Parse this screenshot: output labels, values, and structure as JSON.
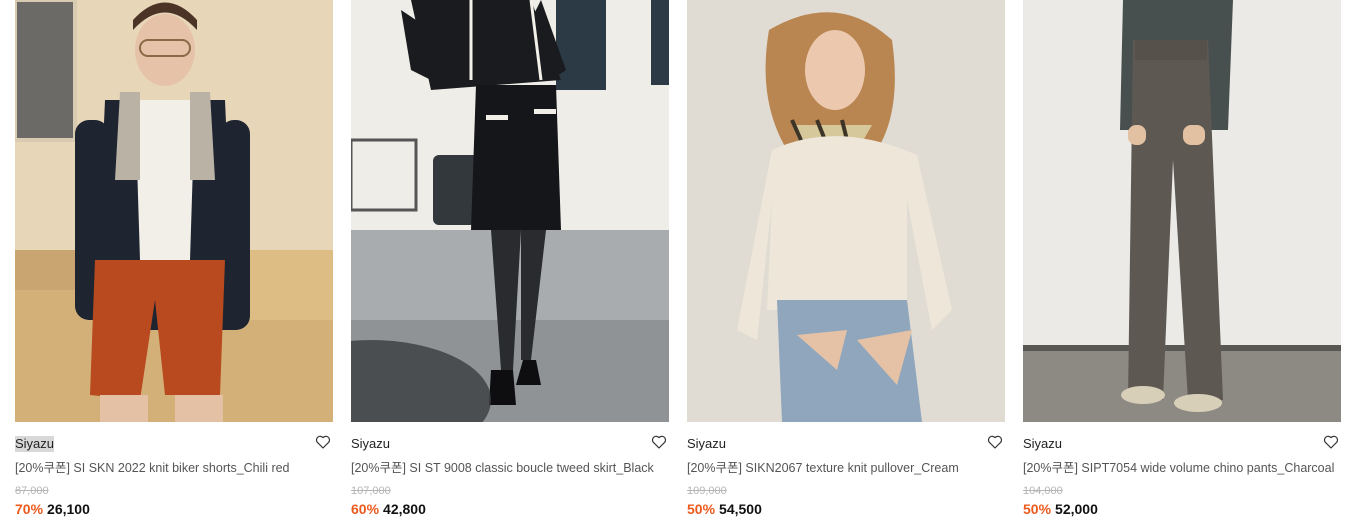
{
  "products": [
    {
      "brand": "Siyazu",
      "name": "[20%쿠폰] SI SKN 2022 knit biker shorts_Chili red",
      "original_price": "87,000",
      "discount": "70%",
      "price": "26,100",
      "image": "model-blazer-biker-shorts"
    },
    {
      "brand": "Siyazu",
      "name": "[20%쿠폰] SI ST 9008 classic boucle tweed skirt_Black",
      "original_price": "107,000",
      "discount": "60%",
      "price": "42,800",
      "image": "model-tweed-skirt"
    },
    {
      "brand": "Siyazu",
      "name": "[20%쿠폰] SIKN2067 texture knit pullover_Cream",
      "original_price": "109,000",
      "discount": "50%",
      "price": "54,500",
      "image": "model-knit-pullover"
    },
    {
      "brand": "Siyazu",
      "name": "[20%쿠폰] SIPT7054 wide volume chino pants_Charcoal",
      "original_price": "104,000",
      "discount": "50%",
      "price": "52,000",
      "image": "model-chino-pants"
    }
  ],
  "icons": {
    "wishlist": "heart-outline-icon"
  },
  "colors": {
    "discount": "#ec5b1c",
    "original_price": "#b5b5b5"
  }
}
